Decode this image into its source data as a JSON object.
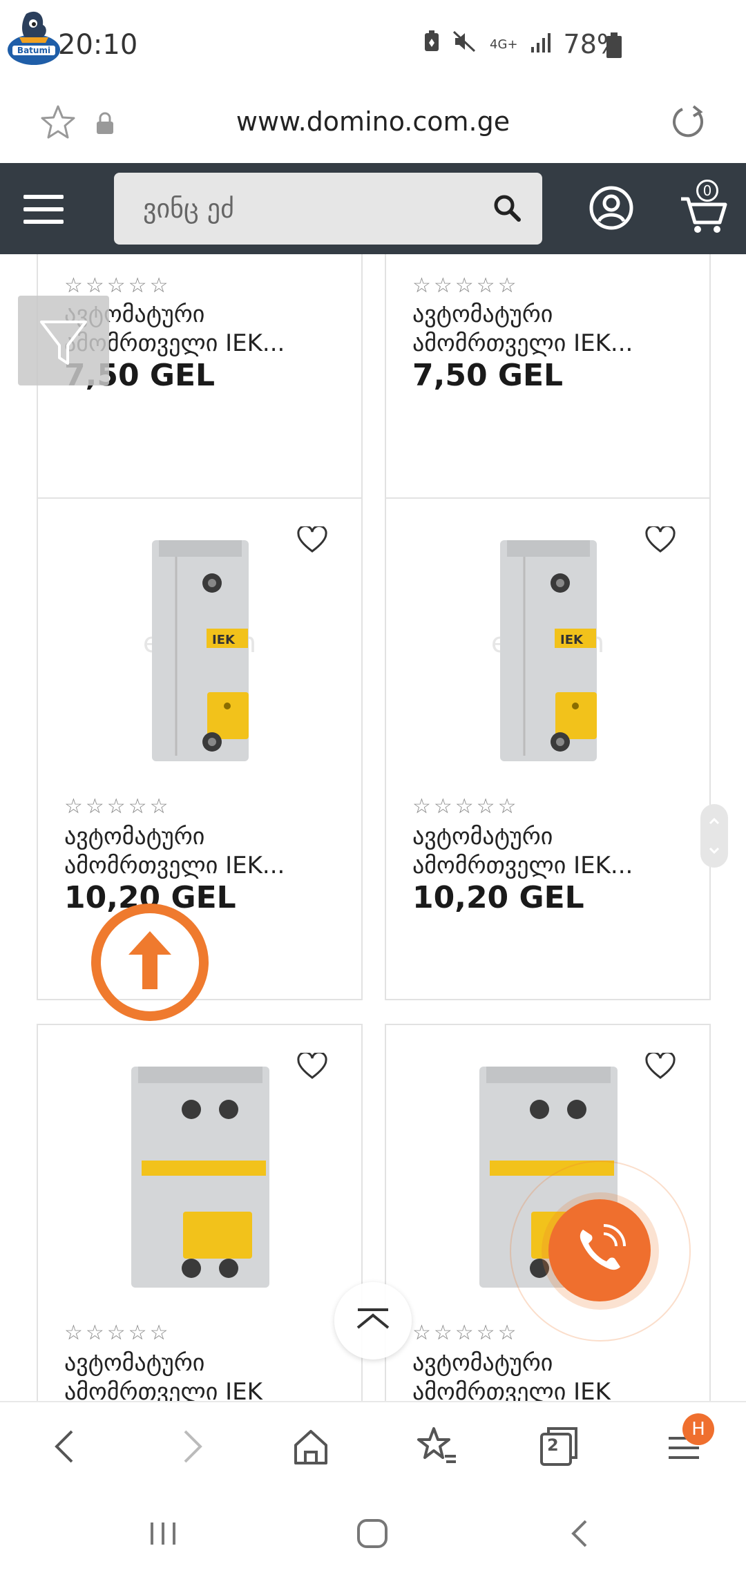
{
  "status_bar": {
    "time": "20:10",
    "network": "4G+",
    "battery": "78%",
    "logo_text": "Batumi"
  },
  "browser": {
    "url": "www.domino.com.ge",
    "tabs_count": "2",
    "menu_badge": "H"
  },
  "header": {
    "search_placeholder": "ვინც ეძ",
    "cart_count": "0"
  },
  "products": [
    {
      "rating": "☆☆☆☆☆",
      "title": "ავტომატური\nამომრთველი IEK...",
      "price": "7,50 GEL"
    },
    {
      "rating": "☆☆☆☆☆",
      "title": "ავტომატური\nამომრთველი IEK...",
      "price": "7,50 GEL"
    },
    {
      "rating": "☆☆☆☆☆",
      "title": "ავტომატური\nამომრთველი IEK...",
      "price": "10,20 GEL",
      "watermark": "emarsm"
    },
    {
      "rating": "☆☆☆☆☆",
      "title": "ავტომატური\nამომრთველი IEK...",
      "price": "10,20 GEL",
      "watermark": "emarsm"
    },
    {
      "rating": "☆☆☆☆☆",
      "title": "ავტომატური\nამომრთველი IEK",
      "price": ""
    },
    {
      "rating": "☆☆☆☆☆",
      "title": "ავტომატური\nამომრთველი IEK",
      "price": ""
    }
  ],
  "colors": {
    "header_bg": "#343c44",
    "accent_orange": "#ef6f2e",
    "breaker_yellow": "#f2c21b"
  }
}
